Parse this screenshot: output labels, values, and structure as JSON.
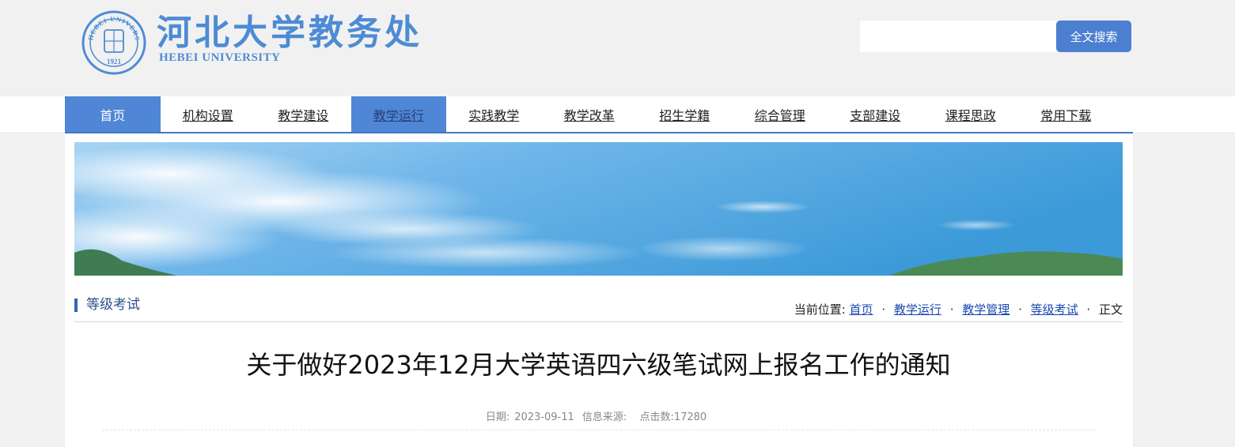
{
  "header": {
    "logo_cn": "河北大学教务处",
    "logo_en": "HEBEI UNIVERSITY",
    "seal_text": "HEBEI UNIVERSITY",
    "seal_year": "1921",
    "search_placeholder": "",
    "search_button": "全文搜索"
  },
  "nav": {
    "items": [
      "首页",
      "机构设置",
      "教学建设",
      "教学运行",
      "实践教学",
      "教学改革",
      "招生学籍",
      "综合管理",
      "支部建设",
      "课程思政",
      "常用下载"
    ],
    "active": "教学运行"
  },
  "section": {
    "title": "等级考试"
  },
  "breadcrumb": {
    "label": "当前位置:",
    "links": [
      "首页",
      "教学运行",
      "教学管理",
      "等级考试"
    ],
    "current": "正文",
    "separator": "·"
  },
  "article": {
    "title": "关于做好2023年12月大学英语四六级笔试网上报名工作的通知",
    "date_label": "日期:",
    "date": "2023-09-11",
    "source_label": "信息来源:",
    "source": "",
    "clicks_label": "点击数:",
    "clicks": "17280"
  },
  "colors": {
    "brand_blue": "#4d8bd4",
    "nav_active": "#4f86d6",
    "button": "#4d7fd0"
  }
}
